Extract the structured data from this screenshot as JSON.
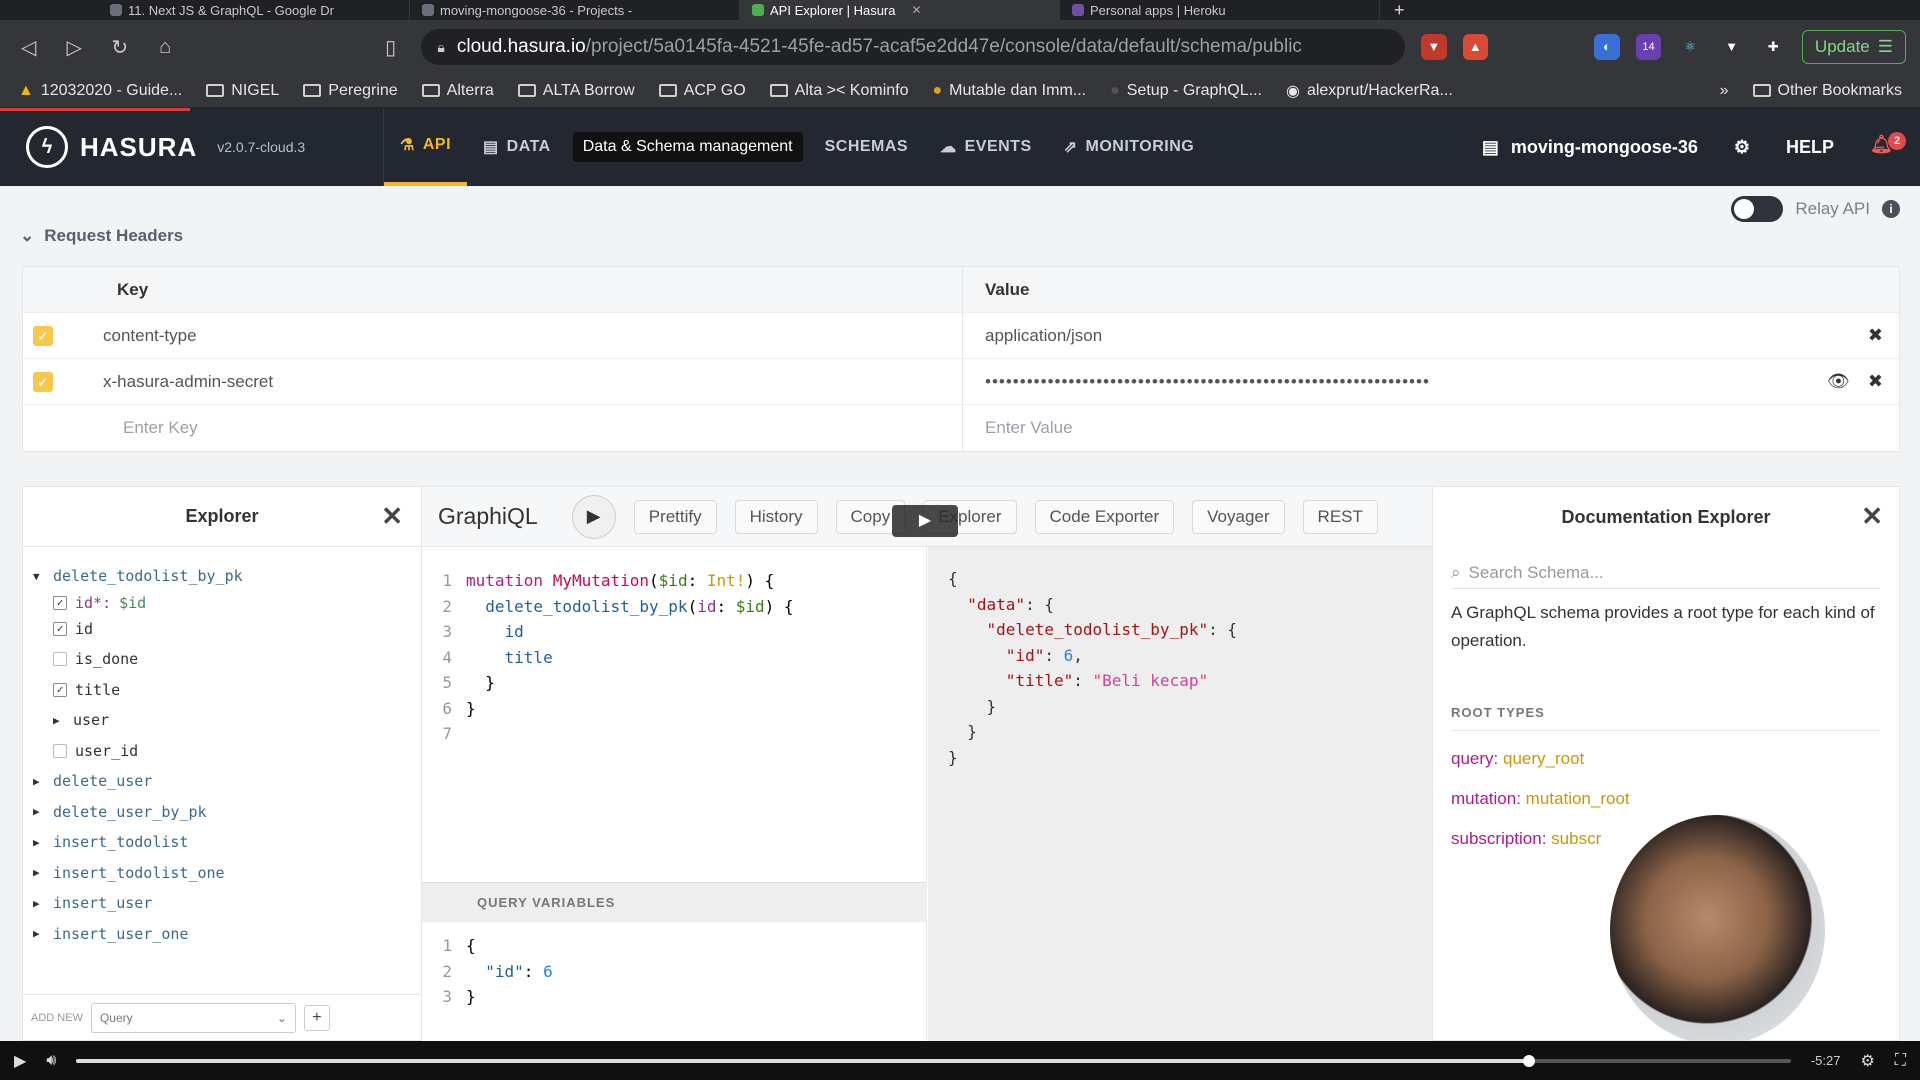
{
  "browser": {
    "tabs": [
      {
        "label": "11. Next JS & GraphQL - Google Dr"
      },
      {
        "label": "moving-mongoose-36 - Projects -"
      },
      {
        "label": "API Explorer | Hasura"
      },
      {
        "label": "Personal apps | Heroku"
      }
    ],
    "url_host": "cloud.hasura.io",
    "url_path": "/project/5a0145fa-4521-45fe-ad57-acaf5e2dd47e/console/data/default/schema/public",
    "ext_badge_1": "14",
    "update_label": "Update",
    "bookmarks": [
      "12032020 - Guide...",
      "NIGEL",
      "Peregrine",
      "Alterra",
      "ALTA Borrow",
      "ACP GO",
      "Alta >< Kominfo",
      "Mutable dan Imm...",
      "Setup - GraphQL...",
      "alexprut/HackerRa..."
    ],
    "other_bookmarks": "Other Bookmarks",
    "more": "»"
  },
  "hasura": {
    "brand": "HASURA",
    "version": "v2.0.7-cloud.3",
    "tabs": {
      "api": "API",
      "data": "DATA",
      "schemas": "SCHEMAS",
      "events": "EVENTS",
      "monitoring": "MONITORING"
    },
    "tooltip": "Data & Schema management",
    "project": "moving-mongoose-36",
    "help": "HELP",
    "notif_count": "2"
  },
  "relay_label": "Relay API",
  "request_headers": {
    "title": "Request Headers",
    "col_key": "Key",
    "col_value": "Value",
    "rows": [
      {
        "key": "content-type",
        "value": "application/json"
      },
      {
        "key": "x-hasura-admin-secret",
        "value": "••••••••••••••••••••••••••••••••••••••••••••••••••••••••••••••••"
      }
    ],
    "key_placeholder": "Enter Key",
    "value_placeholder": "Enter Value"
  },
  "explorer": {
    "title": "Explorer",
    "root": "delete_todolist_by_pk",
    "arg": {
      "name": "id*:",
      "value": "$id"
    },
    "fields": [
      {
        "name": "id",
        "checked": "☑"
      },
      {
        "name": "is_done",
        "checked": ""
      },
      {
        "name": "title",
        "checked": "☑"
      },
      {
        "name": "user",
        "checked": ""
      },
      {
        "name": "user_id",
        "checked": ""
      }
    ],
    "ops": [
      "delete_user",
      "delete_user_by_pk",
      "insert_todolist",
      "insert_todolist_one",
      "insert_user",
      "insert_user_one"
    ],
    "footer_label": "ADD NEW",
    "footer_select": "Query",
    "footer_plus": "+"
  },
  "graphiql": {
    "title": "GraphiQL",
    "buttons": {
      "prettify": "Prettify",
      "history": "History",
      "copy": "Copy",
      "explorer": "Explorer",
      "code": "Code Exporter",
      "voyager": "Voyager",
      "rest": "REST"
    },
    "query_vars_label": "QUERY VARIABLES"
  },
  "docs": {
    "title": "Documentation Explorer",
    "search_placeholder": "Search Schema...",
    "description": "A GraphQL schema provides a root type for each kind of operation.",
    "root_types_label": "ROOT TYPES",
    "query": {
      "k": "query:",
      "t": "query_root"
    },
    "mutation": {
      "k": "mutation:",
      "t": "mutation_root"
    },
    "subscription": {
      "k": "subscription:",
      "t": "subscr"
    }
  },
  "player": {
    "time": "-5:27",
    "progress": 0.847
  }
}
